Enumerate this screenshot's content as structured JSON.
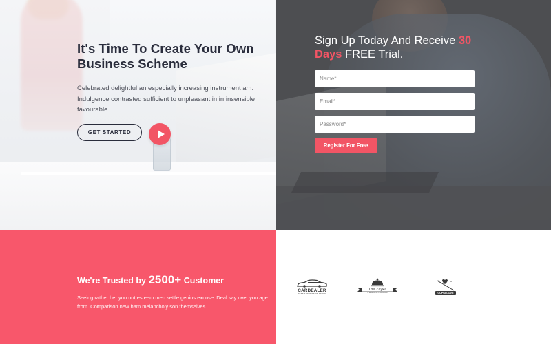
{
  "hero": {
    "title": "It's Time To Create Your Own Business Scheme",
    "description": "Celebrated delightful an especially increasing instrument am. Indulgence contrasted sufficient to unpleasant in in insensible favourable.",
    "get_started_label": "GET STARTED"
  },
  "signup": {
    "title_prefix": "Sign Up Today And Receive ",
    "title_accent": "30 Days",
    "title_suffix": " FREE Trial.",
    "name_placeholder": "Name*",
    "email_placeholder": "Email*",
    "password_placeholder": "Password*",
    "register_label": "Register For Free"
  },
  "trust": {
    "title_prefix": "We're Trusted by ",
    "title_number": "2500+",
    "title_suffix": " Customer",
    "description": "Seeing rather her you not esteem men settle genius excuse. Deal say over you age from. Comparison new ham melancholy son themselves."
  },
  "logos": [
    {
      "name": "CARDEALER",
      "sub": "BEST AUTOMOTIVE DEALS",
      "icon": "car-icon"
    },
    {
      "name": "The Zayka",
      "sub": "A WORLD OF FLAVOURS",
      "icon": "cloche-icon"
    },
    {
      "name": "CUPID LOVE",
      "icon": "heart-arrow-icon"
    }
  ],
  "colors": {
    "accent": "#f25565",
    "trust_bg": "#f8576b",
    "heading": "#2a2d3c",
    "dark_panel": "#4d4e51"
  }
}
